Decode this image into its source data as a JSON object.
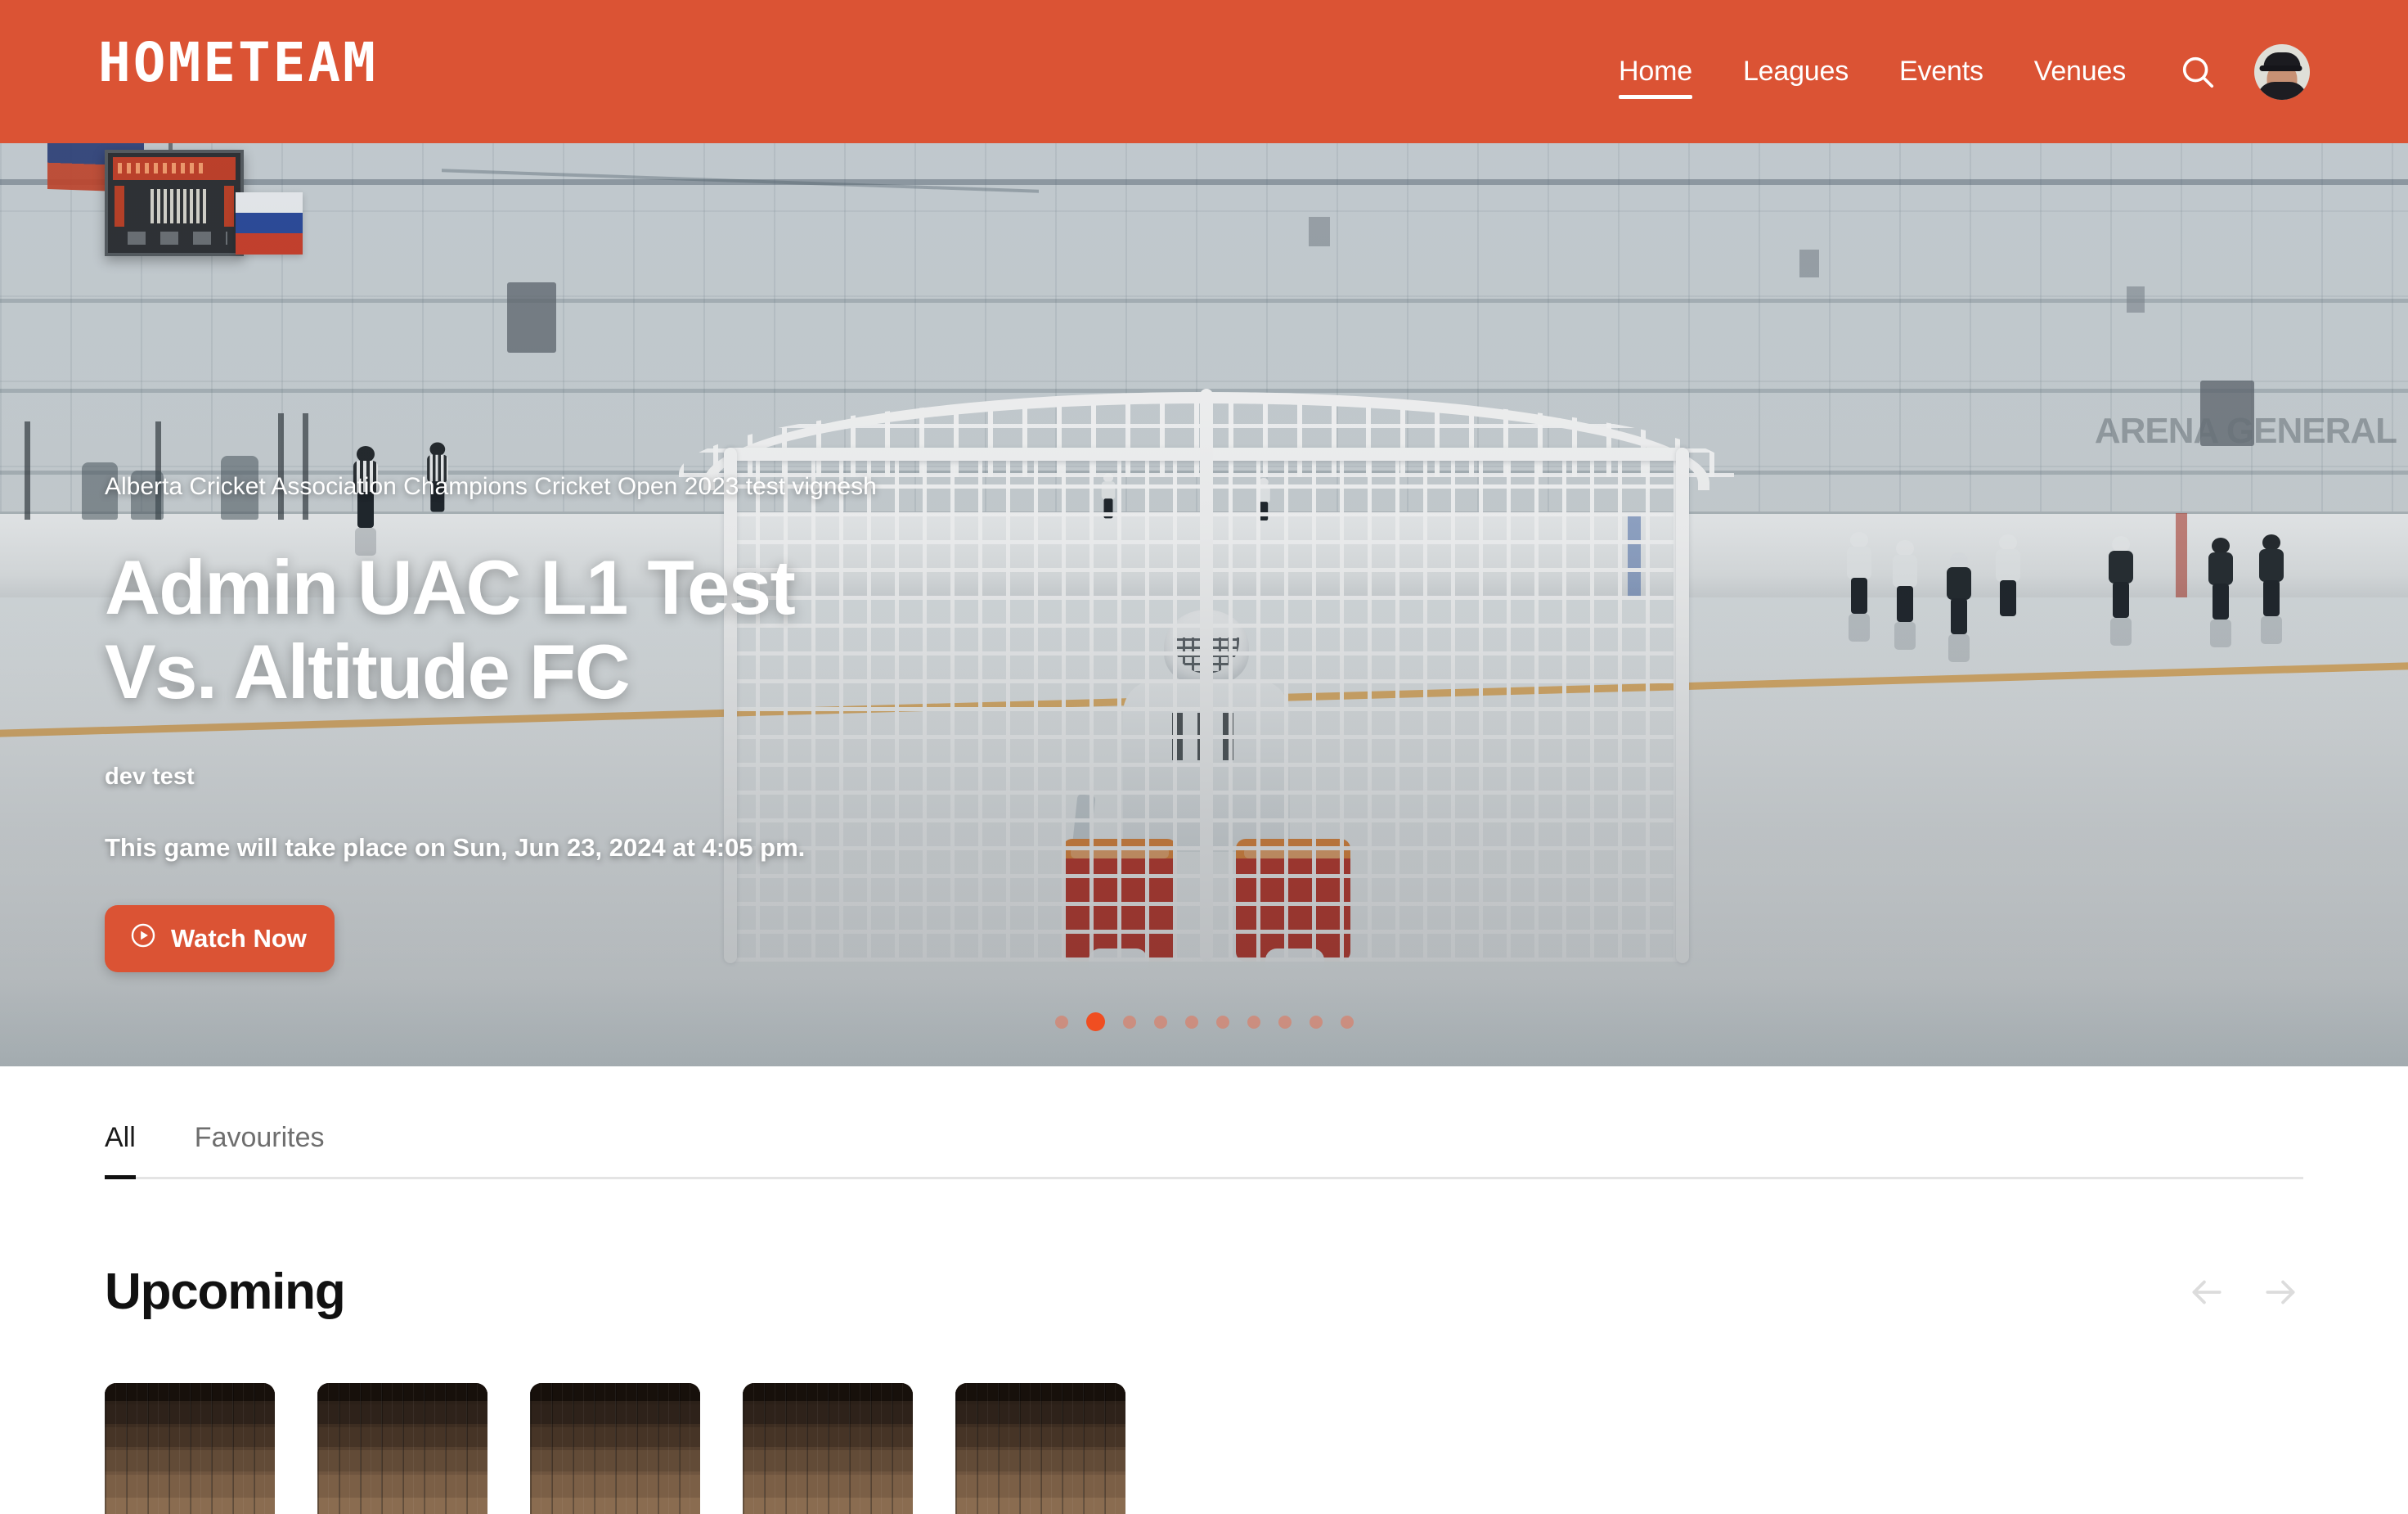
{
  "brand": {
    "logo_text": "HOMETEAM",
    "accent_color": "#db5334",
    "dark_color": "#111111"
  },
  "header": {
    "nav": [
      {
        "label": "Home",
        "active": true
      },
      {
        "label": "Leagues",
        "active": false
      },
      {
        "label": "Events",
        "active": false
      },
      {
        "label": "Venues",
        "active": false
      }
    ],
    "search_icon": "search-icon",
    "avatar_alt": "user-avatar"
  },
  "hero": {
    "eyebrow": "Alberta Cricket Association Champions Cricket Open 2023 test vignesh",
    "title": "Admin UAC L1 Test Vs. Altitude FC",
    "subtitle": "dev test",
    "date_line": "This game will take place on Sun, Jun 23, 2024 at 4:05 pm.",
    "cta_label": "Watch Now",
    "cta_icon": "play-circle-icon",
    "background_alt": "hockey-rink-goal-net",
    "arena_wall_text": "ARENA GENERAL",
    "carousel": {
      "total": 10,
      "active_index": 1
    }
  },
  "main": {
    "tabs": [
      {
        "label": "All",
        "active": true
      },
      {
        "label": "Favourites",
        "active": false
      }
    ],
    "section_title": "Upcoming",
    "prev_label": "←",
    "next_label": "→",
    "cards": [
      {
        "thumb_alt": "stadium-seats-thumbnail"
      },
      {
        "thumb_alt": "stadium-seats-thumbnail"
      },
      {
        "thumb_alt": "stadium-seats-thumbnail"
      },
      {
        "thumb_alt": "stadium-seats-thumbnail"
      },
      {
        "thumb_alt": "stadium-seats-thumbnail"
      }
    ]
  }
}
